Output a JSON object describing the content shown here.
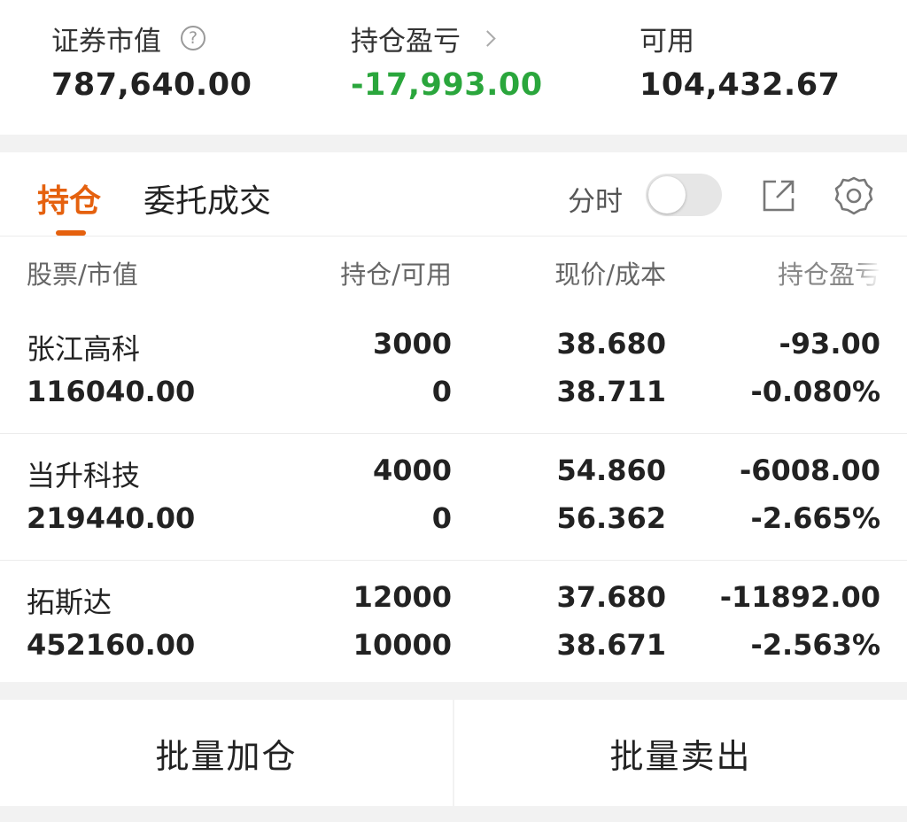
{
  "summary": {
    "market_value_label": "证券市值",
    "market_value": "787,640.00",
    "pnl_label": "持仓盈亏",
    "pnl": "-17,993.00",
    "available_label": "可用",
    "available": "104,432.67"
  },
  "tabs": {
    "positions": "持仓",
    "orders": "委托成交",
    "fenshi_label": "分时",
    "fenshi_on": false
  },
  "columns": [
    "股票/市值",
    "持仓/可用",
    "现价/成本",
    "持仓盈亏"
  ],
  "holdings": [
    {
      "name": "张江高科",
      "market_value": "116040.00",
      "position": "3000",
      "available": "0",
      "price": "38.680",
      "cost": "38.711",
      "pnl": "-93.00",
      "pnl_pct": "-0.080%"
    },
    {
      "name": "当升科技",
      "market_value": "219440.00",
      "position": "4000",
      "available": "0",
      "price": "54.860",
      "cost": "56.362",
      "pnl": "-6008.00",
      "pnl_pct": "-2.665%"
    },
    {
      "name": "拓斯达",
      "market_value": "452160.00",
      "position": "12000",
      "available": "10000",
      "price": "37.680",
      "cost": "38.671",
      "pnl": "-11892.00",
      "pnl_pct": "-2.563%"
    }
  ],
  "buttons": {
    "batch_add": "批量加仓",
    "batch_sell": "批量卖出"
  },
  "colors": {
    "accent": "#e5610e",
    "loss_green": "#2aa63c"
  }
}
